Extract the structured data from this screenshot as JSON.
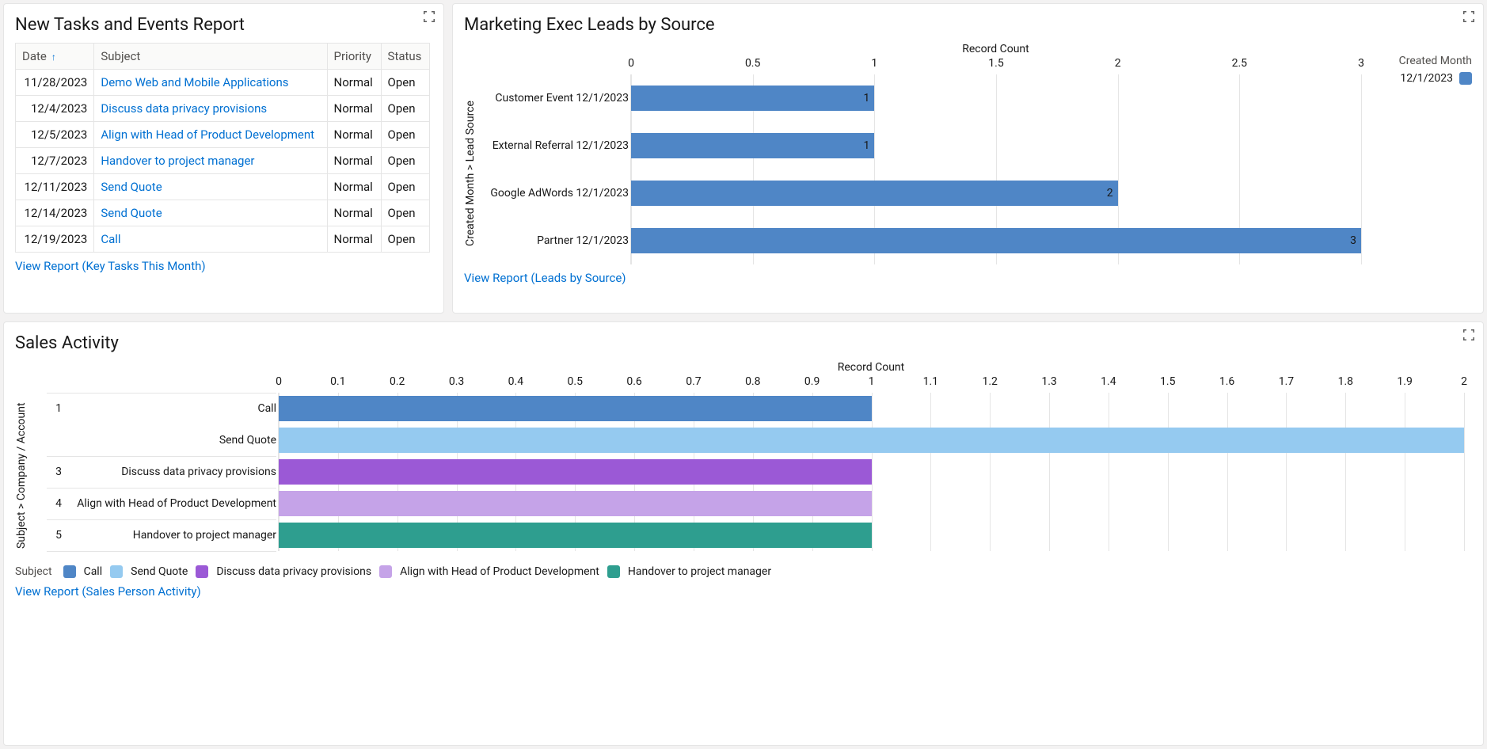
{
  "panels": {
    "tasks": {
      "title": "New Tasks and Events Report",
      "footer_link": "View Report (Key Tasks This Month)",
      "columns": {
        "date": "Date",
        "subject": "Subject",
        "priority": "Priority",
        "status": "Status"
      },
      "rows": [
        {
          "date": "11/28/2023",
          "subject": "Demo Web and Mobile Applications",
          "priority": "Normal",
          "status": "Open"
        },
        {
          "date": "12/4/2023",
          "subject": "Discuss data privacy provisions",
          "priority": "Normal",
          "status": "Open"
        },
        {
          "date": "12/5/2023",
          "subject": "Align with Head of Product Development",
          "priority": "Normal",
          "status": "Open"
        },
        {
          "date": "12/7/2023",
          "subject": "Handover to project manager",
          "priority": "Normal",
          "status": "Open"
        },
        {
          "date": "12/11/2023",
          "subject": "Send Quote",
          "priority": "Normal",
          "status": "Open"
        },
        {
          "date": "12/14/2023",
          "subject": "Send Quote",
          "priority": "Normal",
          "status": "Open"
        },
        {
          "date": "12/19/2023",
          "subject": "Call",
          "priority": "Normal",
          "status": "Open"
        }
      ]
    },
    "leads": {
      "title": "Marketing Exec Leads by Source",
      "footer_link": "View Report (Leads by Source)",
      "x_title": "Record Count",
      "y_title": "Created Month  >  Lead Source",
      "legend_header": "Created Month",
      "legend_item": "12/1/2023",
      "x_ticks": [
        "0",
        "0.5",
        "1",
        "1.5",
        "2",
        "2.5",
        "3"
      ],
      "rows": [
        {
          "source": "Customer Event",
          "month": "12/1/2023",
          "value": 1
        },
        {
          "source": "External Referral",
          "month": "12/1/2023",
          "value": 1
        },
        {
          "source": "Google AdWords",
          "month": "12/1/2023",
          "value": 2
        },
        {
          "source": "Partner",
          "month": "12/1/2023",
          "value": 3
        }
      ],
      "bar_color": "#4f86c6"
    },
    "sales": {
      "title": "Sales Activity",
      "footer_link": "View Report (Sales Person Activity)",
      "x_title": "Record Count",
      "y_title": "Subject  >  Company / Account",
      "legend_label": "Subject",
      "x_ticks": [
        "0",
        "0.1",
        "0.2",
        "0.3",
        "0.4",
        "0.5",
        "0.6",
        "0.7",
        "0.8",
        "0.9",
        "1",
        "1.1",
        "1.2",
        "1.3",
        "1.4",
        "1.5",
        "1.6",
        "1.7",
        "1.8",
        "1.9",
        "2"
      ],
      "group_labels": [
        "1",
        "3",
        "4",
        "5"
      ],
      "rows": [
        {
          "subject": "Call",
          "value": 1,
          "color": "#4f86c6"
        },
        {
          "subject": "Send Quote",
          "value": 2,
          "color": "#95caf0"
        },
        {
          "subject": "Discuss data privacy provisions",
          "value": 1,
          "color": "#9b59d6"
        },
        {
          "subject": "Align with Head of Product Development",
          "value": 1,
          "color": "#c5a3e8"
        },
        {
          "subject": "Handover to project manager",
          "value": 1,
          "color": "#2e9e8f"
        }
      ]
    }
  },
  "chart_data": [
    {
      "type": "bar",
      "orientation": "horizontal",
      "title": "Marketing Exec Leads by Source",
      "xlabel": "Record Count",
      "ylabel": "Created Month > Lead Source",
      "xlim": [
        0,
        3
      ],
      "categories": [
        "Customer Event",
        "External Referral",
        "Google AdWords",
        "Partner"
      ],
      "sub_category": "12/1/2023",
      "values": [
        1,
        1,
        2,
        3
      ],
      "series_name": "12/1/2023",
      "legend_title": "Created Month"
    },
    {
      "type": "bar",
      "orientation": "horizontal",
      "title": "Sales Activity",
      "xlabel": "Record Count",
      "ylabel": "Subject > Company / Account",
      "xlim": [
        0,
        2
      ],
      "categories": [
        "Call",
        "Send Quote",
        "Discuss data privacy provisions",
        "Align with Head of Product Development",
        "Handover to project manager"
      ],
      "values": [
        1,
        2,
        1,
        1,
        1
      ],
      "legend_title": "Subject",
      "colors": [
        "#4f86c6",
        "#95caf0",
        "#9b59d6",
        "#c5a3e8",
        "#2e9e8f"
      ]
    }
  ]
}
